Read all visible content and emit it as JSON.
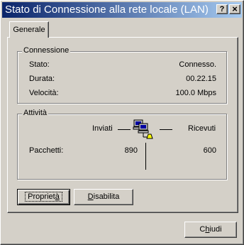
{
  "window": {
    "title": "Stato di Connessione alla rete locale (LAN)",
    "help_button": "?",
    "close_button": "×"
  },
  "tabs": [
    {
      "label": "Generale"
    }
  ],
  "connection": {
    "legend": "Connessione",
    "rows": [
      {
        "label": "Stato:",
        "value": "Connesso."
      },
      {
        "label": "Durata:",
        "value": "00.22.15"
      },
      {
        "label": "Velocità:",
        "value": "100.0 Mbps"
      }
    ]
  },
  "activity": {
    "legend": "Attività",
    "sent_label": "Inviati",
    "received_label": "Ricevuti",
    "packets_label": "Pacchetti:",
    "packets_sent": "890",
    "packets_received": "600",
    "icon": "network-computers-icon"
  },
  "buttons": {
    "properties_prefix": "Propriet",
    "properties_access": "à",
    "disable_access": "D",
    "disable_rest": "isabilita",
    "close_prefix": "C",
    "close_access": "h",
    "close_rest": "iudi"
  }
}
